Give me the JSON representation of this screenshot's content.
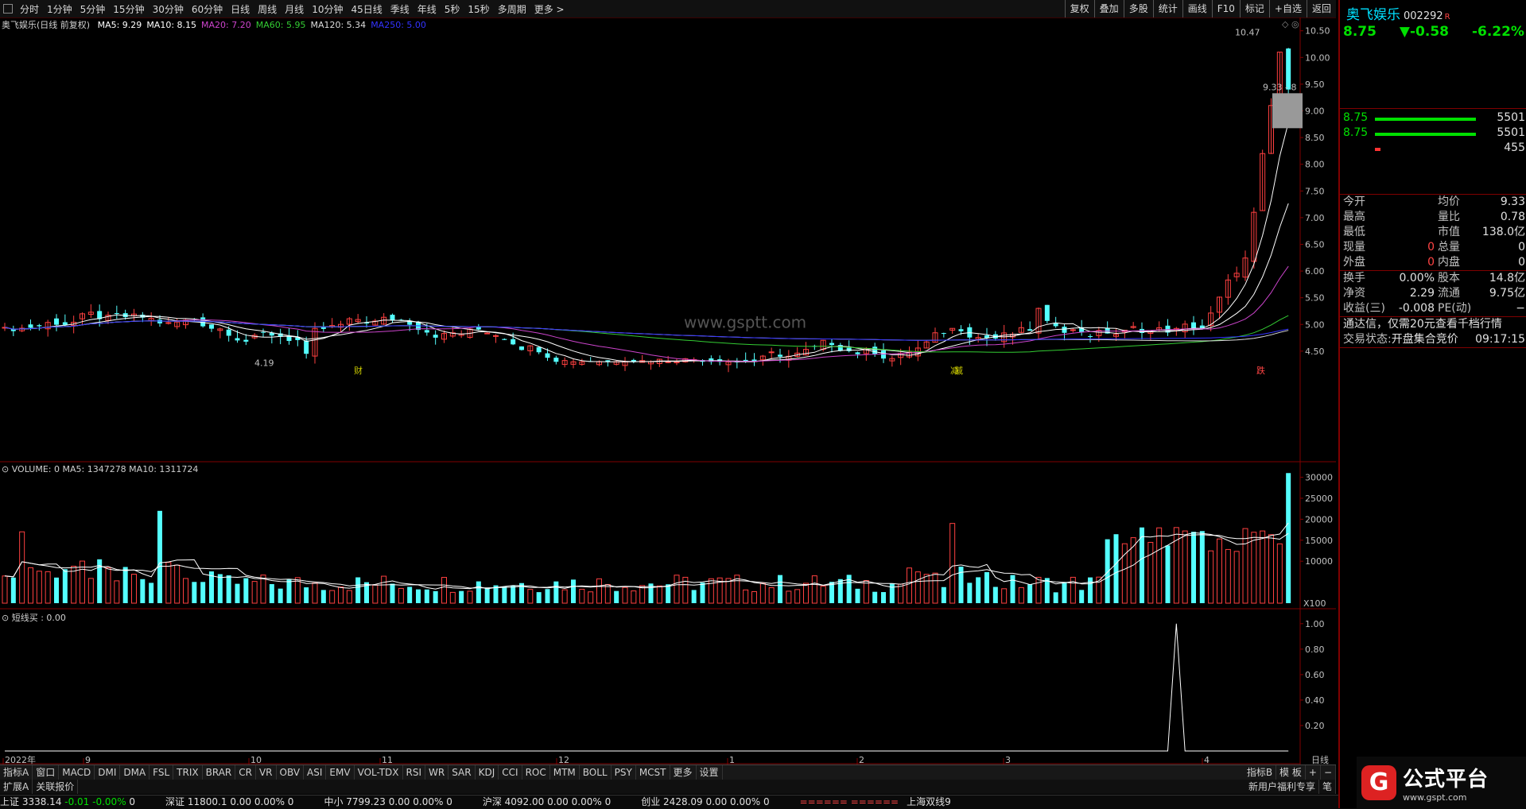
{
  "toolbar": {
    "periods": [
      "分时",
      "1分钟",
      "5分钟",
      "15分钟",
      "30分钟",
      "60分钟",
      "日线",
      "周线",
      "月线",
      "10分钟",
      "45日线",
      "季线",
      "年线",
      "5秒",
      "15秒",
      "多周期",
      "更多 >"
    ],
    "right_buttons": [
      "复权",
      "叠加",
      "多股",
      "统计",
      "画线",
      "F10",
      "标记",
      "+自选",
      "返回"
    ]
  },
  "main_chart": {
    "title": "奥飞娱乐(日线 前复权)",
    "ma_legend": [
      {
        "text": "MA5: 9.29",
        "color": "#ffffff"
      },
      {
        "text": "MA10: 8.15",
        "color": "#ffffff"
      },
      {
        "text": "MA20: 7.20",
        "color": "#cc44cc"
      },
      {
        "text": "MA60: 5.95",
        "color": "#33cc33"
      },
      {
        "text": "MA120: 5.34",
        "color": "#dddddd"
      },
      {
        "text": "MA250: 5.00",
        "color": "#3333ff"
      }
    ],
    "y_ticks": [
      "10.50",
      "10.00",
      "9.50",
      "9.00",
      "8.50",
      "8.00",
      "7.50",
      "7.00",
      "6.50",
      "6.00",
      "5.50",
      "5.00",
      "4.50"
    ],
    "high_label": "10.47",
    "low_label": "4.19",
    "price_tag": "9.33 - 8",
    "markers": [
      "财",
      "减",
      "减",
      "跌"
    ],
    "watermark": "www.gsptt.com"
  },
  "volume_chart": {
    "title": "VOLUME: 0  MA5: 1347278  MA10: 1311724",
    "y_ticks": [
      "30000",
      "25000",
      "20000",
      "15000",
      "10000"
    ],
    "unit": "X100"
  },
  "indicator_chart": {
    "title": "短线买 : 0.00",
    "y_ticks": [
      "1.00",
      "0.80",
      "0.60",
      "0.40",
      "0.20"
    ]
  },
  "x_axis": {
    "labels": [
      "2022年",
      "9",
      "10",
      "11",
      "12",
      "1",
      "2",
      "3",
      "4"
    ],
    "period": "日线"
  },
  "tabs": [
    "指标A",
    "窗口",
    "MACD",
    "DMI",
    "DMA",
    "FSL",
    "TRIX",
    "BRAR",
    "CR",
    "VR",
    "OBV",
    "ASI",
    "EMV",
    "VOL-TDX",
    "RSI",
    "WR",
    "SAR",
    "KDJ",
    "CCI",
    "ROC",
    "MTM",
    "BOLL",
    "PSY",
    "MCST",
    "更多",
    "设置"
  ],
  "tabs_right": [
    "指标B",
    "模 板",
    "+",
    "−"
  ],
  "ext_tabs": [
    "扩展A",
    "关联报价"
  ],
  "ext_right": [
    "新用户福利专享",
    "笔"
  ],
  "status": [
    {
      "name": "上证",
      "value": "3338.14",
      "chg": "-0.01",
      "pct": "-0.00%",
      "vol": "0"
    },
    {
      "name": "深证",
      "value": "11800.1",
      "chg": "0.00",
      "pct": "0.00%",
      "vol": "0"
    },
    {
      "name": "中小",
      "value": "7799.23",
      "chg": "0.00",
      "pct": "0.00%",
      "vol": "0"
    },
    {
      "name": "沪深",
      "value": "4092.00",
      "chg": "0.00",
      "pct": "0.00%",
      "vol": "0"
    },
    {
      "name": "创业",
      "value": "2428.09",
      "chg": "0.00",
      "pct": "0.00%",
      "vol": "0"
    }
  ],
  "status_extra": [
    "====== ======",
    "上海双线9"
  ],
  "right_panel": {
    "name": "奥飞娱乐",
    "code": "002292",
    "badge": "R",
    "price": "8.75",
    "change": "▼-0.58",
    "pct": "-6.22%",
    "book": [
      {
        "p": "8.75",
        "v": "5501",
        "bar": 0.85,
        "color": "#00e000"
      },
      {
        "p": "8.75",
        "v": "5501",
        "bar": 0.85,
        "color": "#00e000"
      },
      {
        "p": "",
        "v": "455",
        "bar": 0.05,
        "color": "#ff3333"
      }
    ],
    "stats": [
      [
        "今开",
        "",
        "均价",
        "9.33"
      ],
      [
        "最高",
        "",
        "量比",
        "0.78"
      ],
      [
        "最低",
        "",
        "市值",
        "138.0亿"
      ],
      [
        "现量",
        "0",
        "总量",
        "0"
      ],
      [
        "外盘",
        "0",
        "内盘",
        "0"
      ]
    ],
    "fund": [
      [
        "换手",
        "0.00%",
        "股本",
        "14.8亿"
      ],
      [
        "净资",
        "2.29",
        "流通",
        "9.75亿"
      ],
      [
        "收益(三)",
        "-0.008",
        "PE(动)",
        "−"
      ]
    ],
    "notice": "通达信，仅需20元查看千档行情",
    "trade_status_label": "交易状态:",
    "trade_status": "开盘集合竞价",
    "trade_time": "09:17:15"
  },
  "logo": {
    "text": "公式平台",
    "url": "www.gspt.com"
  }
}
